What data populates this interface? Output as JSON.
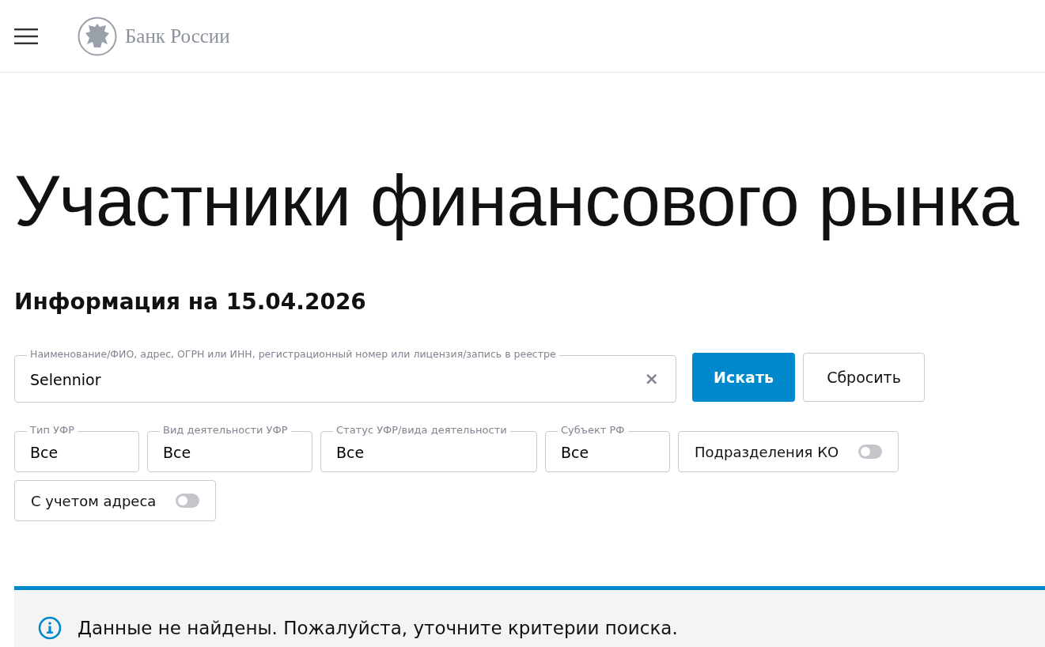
{
  "header": {
    "logo_text": "Банк России"
  },
  "title": "Участники финансового рынка",
  "subtitle": "Информация на 15.04.2026",
  "search": {
    "label": "Наименование/ФИО, адрес, ОГРН или ИНН, регистрационный номер или лицензия/запись в реестре",
    "value": "Selennior",
    "clear": "×"
  },
  "buttons": [
    {
      "label": "Искать",
      "kind": "primary"
    },
    {
      "label": "Сбросить",
      "kind": "secondary"
    }
  ],
  "filters": [
    {
      "kind": "select",
      "label": "Тип УФР",
      "value": "Все"
    },
    {
      "kind": "select",
      "label": "Вид деятельности УФР",
      "value": "Все"
    },
    {
      "kind": "select",
      "label": "Статус УФР/вида деятельности",
      "value": "Все"
    },
    {
      "kind": "select",
      "label": "Субъект РФ",
      "value": "Все"
    },
    {
      "kind": "toggle",
      "label": "Подразделения КО",
      "on": false
    },
    {
      "kind": "toggle",
      "label": "С учетом адреса",
      "on": false
    }
  ],
  "notice": {
    "text": "Данные не найдены. Пожалуйста, уточните критерии поиска."
  }
}
